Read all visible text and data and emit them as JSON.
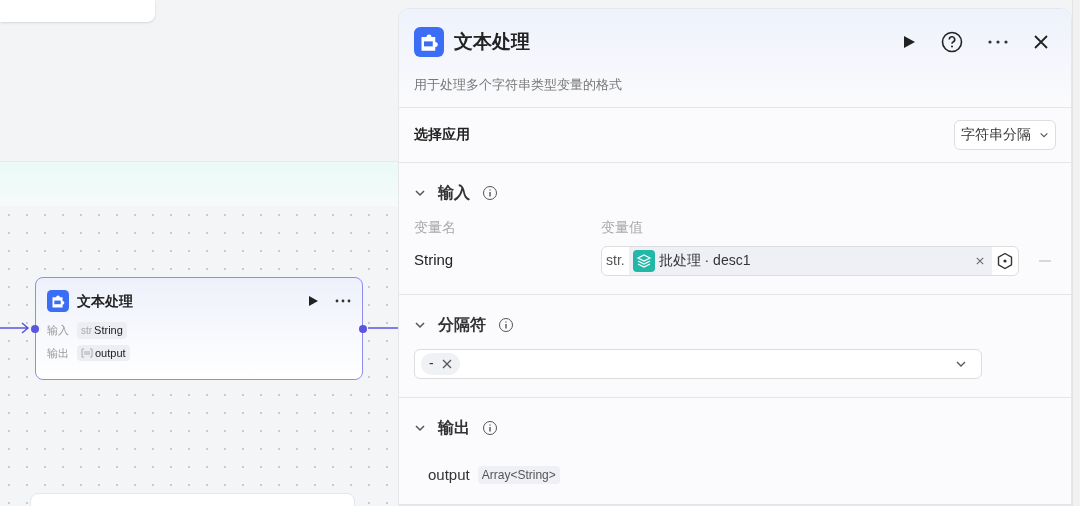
{
  "canvas": {
    "node": {
      "title": "文本处理",
      "selected": true,
      "ports": [
        {
          "label": "输入",
          "kind": "string",
          "tag": "str",
          "name": "String"
        },
        {
          "label": "输出",
          "kind": "array",
          "name": "output"
        }
      ]
    }
  },
  "panel": {
    "title": "文本处理",
    "description": "用于处理多个字符串类型变量的格式",
    "app_select": {
      "label": "选择应用",
      "value": "字符串分隔"
    },
    "sections": [
      {
        "kind": "input",
        "title": "输入",
        "expanded": true,
        "columns": [
          "变量名",
          "变量值"
        ],
        "rows": [
          {
            "name": "String",
            "type": "str.",
            "reference": "批处理 · desc1"
          }
        ]
      },
      {
        "kind": "separator",
        "title": "分隔符",
        "expanded": true,
        "tags": [
          "-"
        ]
      },
      {
        "kind": "output",
        "title": "输出",
        "expanded": true,
        "rows": [
          {
            "name": "output",
            "type": "Array<String>"
          }
        ]
      }
    ]
  }
}
